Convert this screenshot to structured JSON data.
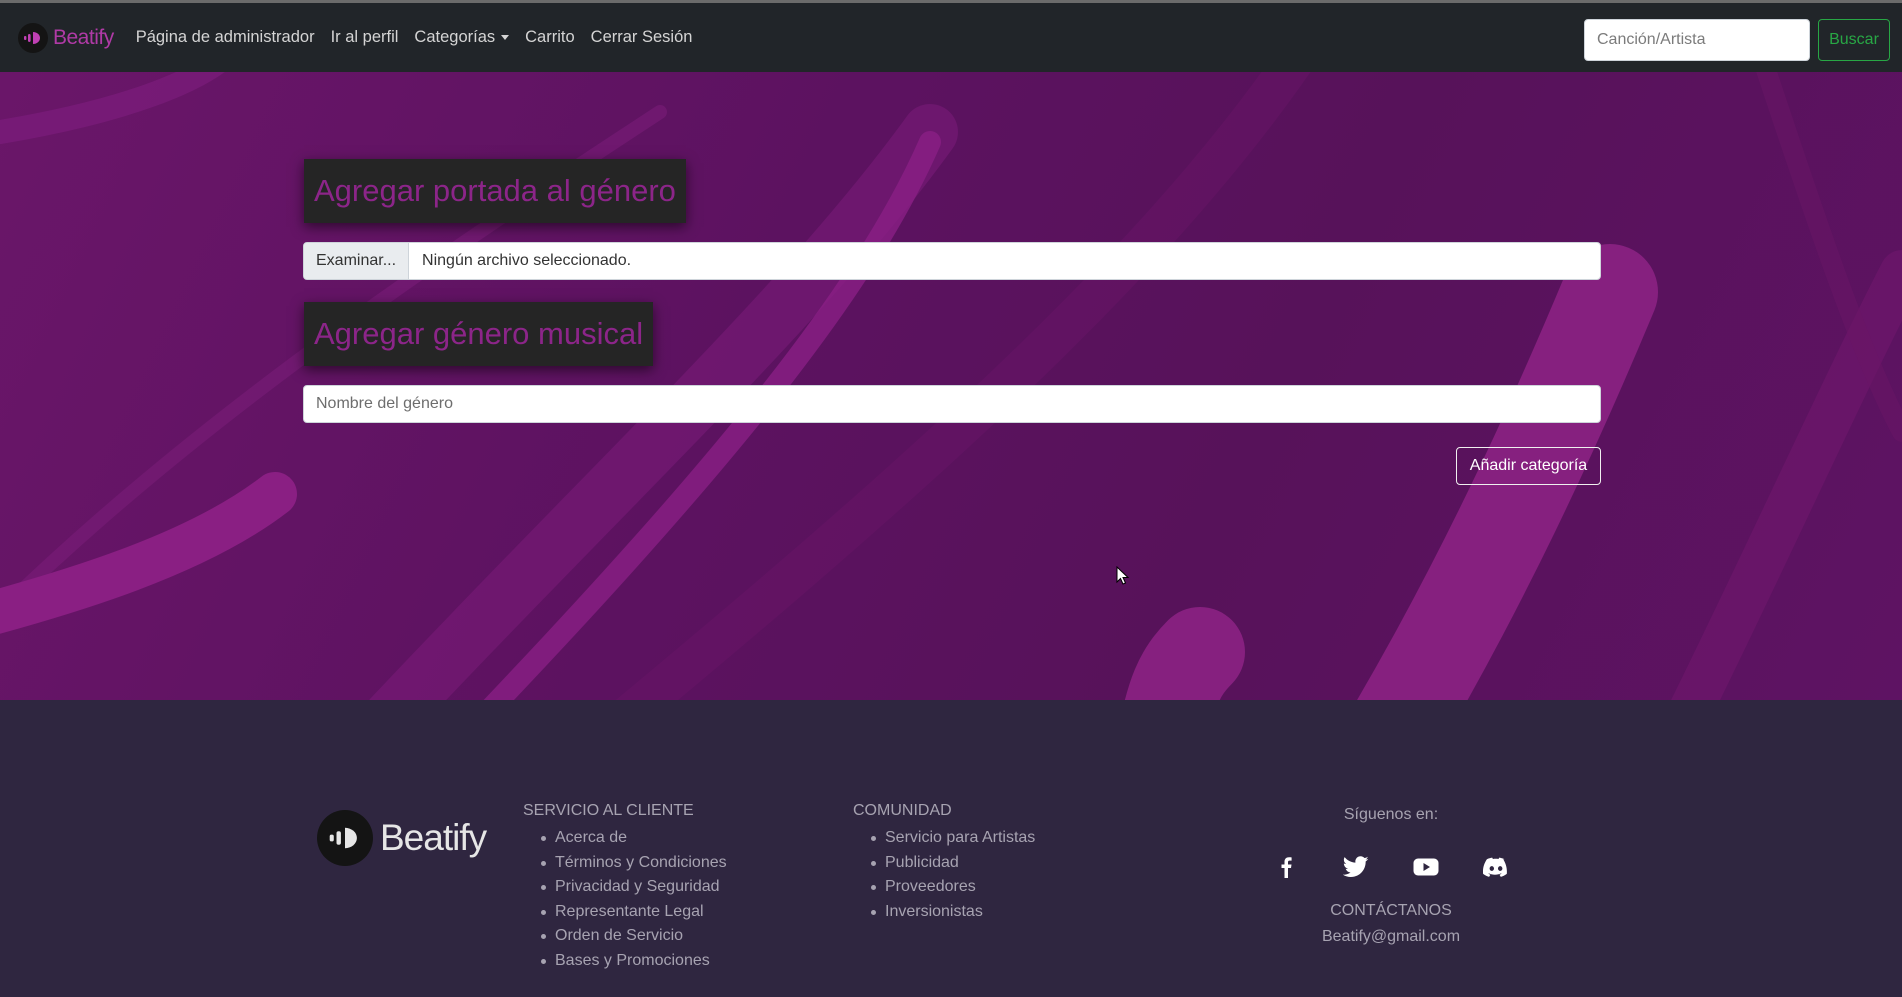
{
  "navbar": {
    "brand": "Beatify",
    "links": {
      "admin": "Página de administrador",
      "profile": "Ir al perfil",
      "categories": "Categorías",
      "cart": "Carrito",
      "logout": "Cerrar Sesión"
    },
    "search": {
      "placeholder": "Canción/Artista",
      "button": "Buscar"
    }
  },
  "main": {
    "cover_title": "Agregar portada al género",
    "file_button": "Examinar...",
    "file_status": "Ningún archivo seleccionado.",
    "genre_title": "Agregar género musical",
    "genre_placeholder": "Nombre del género",
    "add_button": "Añadir categoría"
  },
  "footer": {
    "brand": "Beatify",
    "customer_service": {
      "heading": "SERVICIO AL CLIENTE",
      "items": [
        "Acerca de",
        "Términos y Condiciones",
        "Privacidad y Seguridad",
        "Representante Legal",
        "Orden de Servicio",
        "Bases y Promociones"
      ]
    },
    "community": {
      "heading": "COMUNIDAD",
      "items": [
        "Servicio para Artistas",
        "Publicidad",
        "Proveedores",
        "Inversionistas"
      ]
    },
    "social": {
      "heading": "Síguenos en:",
      "icons": [
        "facebook-icon",
        "twitter-icon",
        "youtube-icon",
        "discord-icon"
      ],
      "contact_heading": "CONTÁCTANOS",
      "email": "Beatify@gmail.com"
    }
  },
  "colors": {
    "navbar": "#212529",
    "brand": "#b03aa6",
    "hero": "#5c1260",
    "title_text": "#8c2589",
    "search_button": "#28a745",
    "footer": "#2f2640"
  }
}
